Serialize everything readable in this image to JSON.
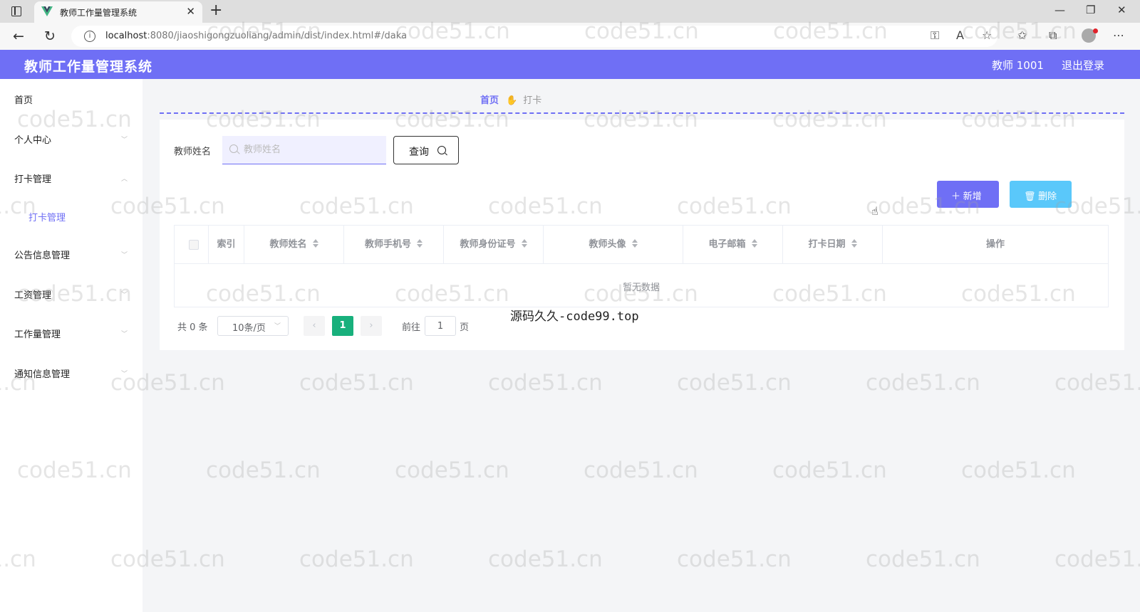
{
  "browser": {
    "tab_title": "教师工作量管理系统",
    "url_host": "localhost",
    "url_rest": ":8080/jiaoshigongzuoliang/admin/dist/index.html#/daka"
  },
  "header": {
    "app_title": "教师工作量管理系统",
    "user_label": "教师 1001",
    "logout_label": "退出登录"
  },
  "sidebar": {
    "items": [
      {
        "label": "首页"
      },
      {
        "label": "个人中心"
      },
      {
        "label": "打卡管理"
      },
      {
        "label": "公告信息管理"
      },
      {
        "label": "工资管理"
      },
      {
        "label": "工作量管理"
      },
      {
        "label": "通知信息管理"
      }
    ],
    "sub_item": "打卡管理"
  },
  "breadcrumb": {
    "home": "首页",
    "current": "打卡"
  },
  "search": {
    "label": "教师姓名",
    "placeholder": "教师姓名",
    "button": "查询"
  },
  "actions": {
    "add": "＋ 新增",
    "delete": "🗑 删除"
  },
  "table": {
    "columns": [
      "索引",
      "教师姓名",
      "教师手机号",
      "教师身份证号",
      "教师头像",
      "电子邮箱",
      "打卡日期",
      "操作"
    ],
    "empty_text": "暂无数据"
  },
  "pagination": {
    "total": "共 0 条",
    "page_size": "10条/页",
    "current_page": "1",
    "goto_label": "前往",
    "goto_value": "1",
    "goto_suffix": "页"
  },
  "overlay": {
    "caption": "源码久久-code99.top",
    "watermark": "code51.cn"
  },
  "colors": {
    "primary": "#6f6ff5",
    "danger_btn": "#5ac8fa",
    "active_page": "#18b07c"
  }
}
